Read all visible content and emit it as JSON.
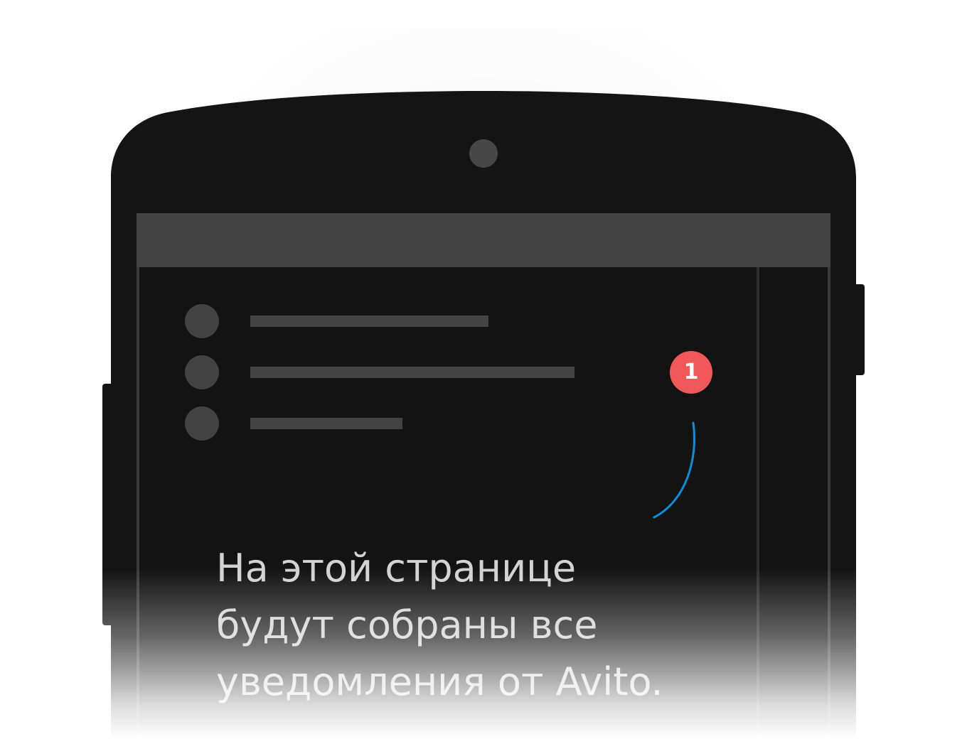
{
  "notifications_placeholder": {
    "badge_count": "1",
    "message_lines": [
      "На этой странице",
      "будут собраны все",
      "уведомления от Avito."
    ],
    "placeholder_rows": [
      {
        "line_length": 0.36
      },
      {
        "line_length": 0.49
      },
      {
        "line_length": 0.23
      }
    ]
  },
  "colors": {
    "device_body": "#141414",
    "screen": "#131313",
    "app_bar": "#434343",
    "placeholder": "#434343",
    "badge": "#f0585a",
    "arrow": "#0a8ede",
    "text": "#d2d2d2"
  },
  "icons": {
    "camera": "camera-icon",
    "arrow": "curved-arrow-icon"
  }
}
